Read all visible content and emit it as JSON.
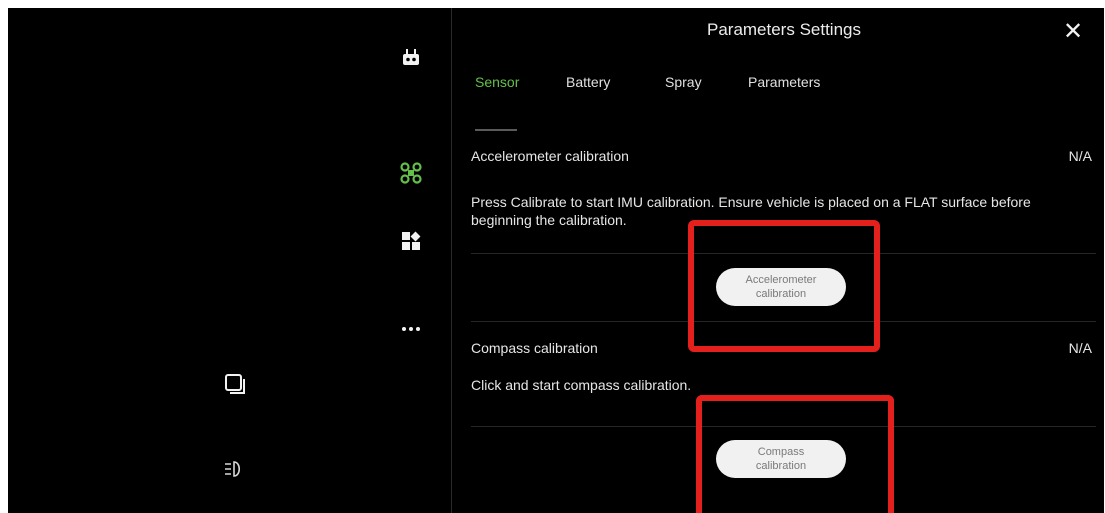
{
  "rail": {
    "icons": [
      "remote-controller-icon",
      "drone-icon",
      "apps-grid-icon",
      "more-icon"
    ],
    "active_color": "#64c04a"
  },
  "bottom_icons": [
    "layers-icon",
    "headlight-icon"
  ],
  "panel": {
    "title": "Parameters Settings",
    "close_label": "✕"
  },
  "tabs": [
    {
      "label": "Sensor",
      "active": true
    },
    {
      "label": "Battery",
      "active": false
    },
    {
      "label": "Spray",
      "active": false
    },
    {
      "label": "Parameters",
      "active": false
    }
  ],
  "accelerometer": {
    "label": "Accelerometer calibration",
    "value": "N/A",
    "description": "Press Calibrate to start IMU calibration. Ensure vehicle is placed on a FLAT surface before beginning the calibration.",
    "button_line1": "Accelerometer",
    "button_line2": "calibration"
  },
  "compass": {
    "label": "Compass calibration",
    "value": "N/A",
    "description": "Click and start compass calibration.",
    "button_line1": "Compass",
    "button_line2": "calibration"
  },
  "colors": {
    "accent": "#64c04a",
    "annotation": "#e3201c",
    "background": "#000000"
  }
}
